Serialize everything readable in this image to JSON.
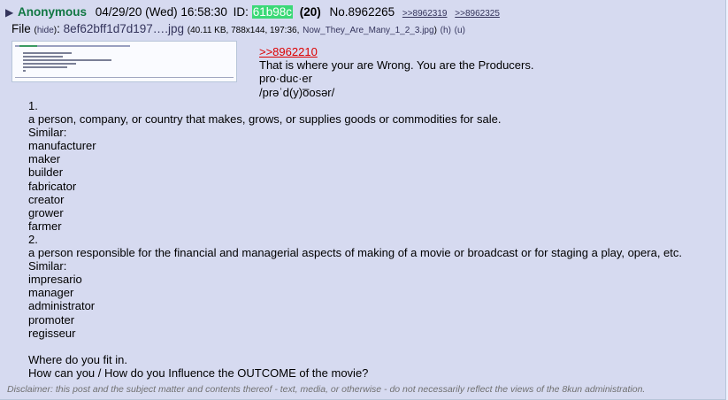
{
  "post": {
    "name": "Anonymous",
    "date": "04/29/20 (Wed) 16:58:30",
    "id_label": "ID:",
    "poster_id": "61b98c",
    "post_count": "(20)",
    "number": "No.8962265",
    "backlinks": [
      ">>8962319",
      ">>8962325"
    ],
    "colors": {
      "post_bg": "#d6daf0",
      "name": "#117743",
      "id_bg": "#3bd977",
      "quotelink": "#dd0000",
      "link": "#34345c"
    }
  },
  "file": {
    "label": "File",
    "hide": "hide",
    "filename": "8ef62bff1d7d197….jpg",
    "info_prefix": "(40.11 KB, 788x144, 197:36,",
    "original_name": "Now_They_Are_Many_1_2_3.jpg",
    "h_link": "(h)",
    "u_link": "(u)"
  },
  "body": {
    "quote": ">>8962210",
    "upper_lines": [
      "That is where your are Wrong. You are the Producers.",
      "pro·duc·er",
      "/prəˈd(y)o̅osər/"
    ],
    "lower_lines": [
      "1.",
      "a person, company, or country that makes, grows, or supplies goods or commodities for sale.",
      "Similar:",
      "manufacturer",
      "maker",
      "builder",
      "fabricator",
      "creator",
      "grower",
      "farmer",
      "2.",
      "a person responsible for the financial and managerial aspects of making of a movie or broadcast or for staging a play, opera, etc.",
      "Similar:",
      "impresario",
      "manager",
      "administrator",
      "promoter",
      "regisseur",
      "",
      "Where do you fit in.",
      "How can you / How do you Influence the OUTCOME of the movie?"
    ]
  },
  "disclaimer": "Disclaimer: this post and the subject matter and contents thereof - text, media, or otherwise - do not necessarily reflect the views of the 8kun administration."
}
